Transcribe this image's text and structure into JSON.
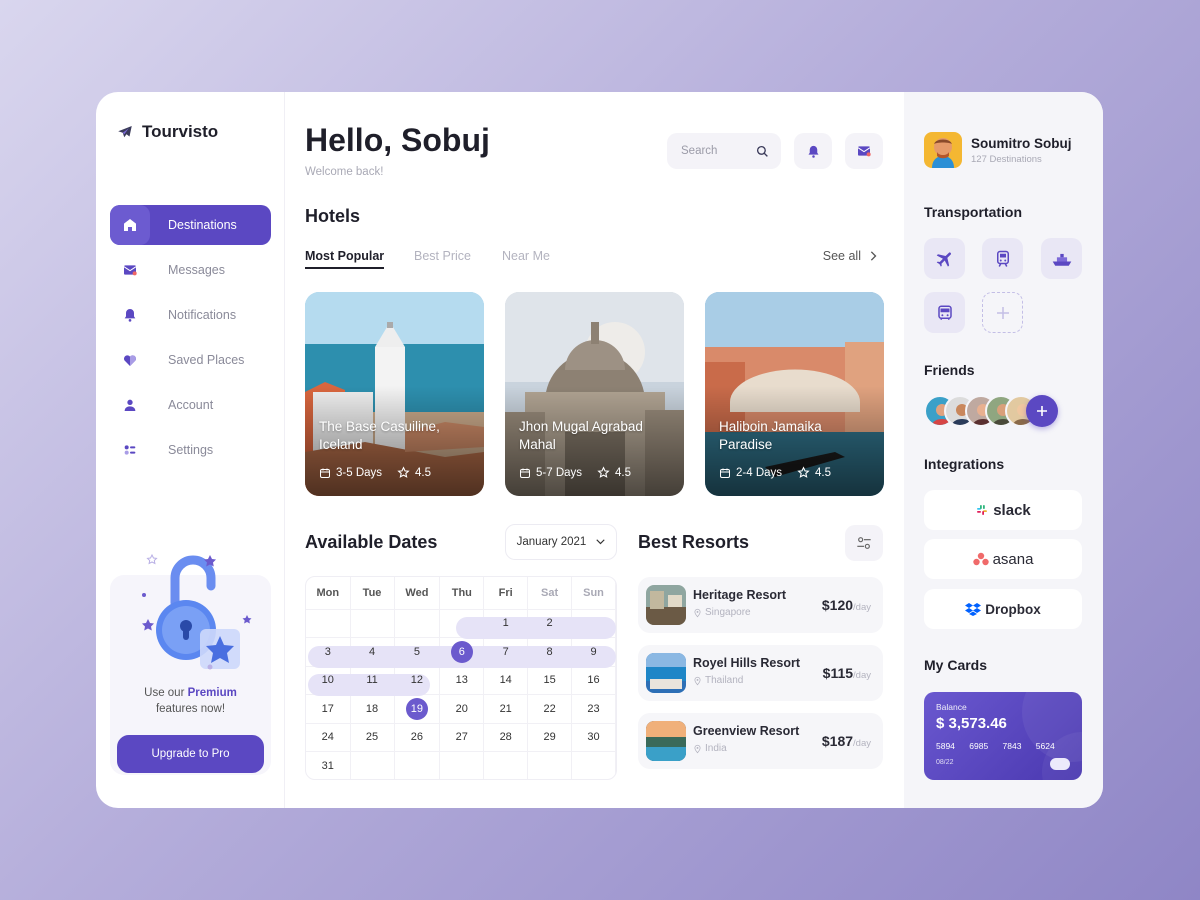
{
  "app": {
    "name": "Tourvisto"
  },
  "sidebar": {
    "items": [
      {
        "label": "Destinations",
        "icon": "home-icon",
        "active": true
      },
      {
        "label": "Messages",
        "icon": "mail-icon"
      },
      {
        "label": "Notifications",
        "icon": "bell-icon"
      },
      {
        "label": "Saved Places",
        "icon": "heart-icon"
      },
      {
        "label": "Account",
        "icon": "user-icon"
      },
      {
        "label": "Settings",
        "icon": "settings-icon"
      }
    ],
    "promo": {
      "text_before": "Use our",
      "highlight": "Premium",
      "text_after": "features now!",
      "button": "Upgrade to Pro"
    }
  },
  "header": {
    "greeting": "Hello, Sobuj",
    "subtitle": "Welcome back!",
    "search_placeholder": "Search"
  },
  "hotels": {
    "title": "Hotels",
    "tabs": [
      "Most Popular",
      "Best Price",
      "Near Me"
    ],
    "active_tab": "Most Popular",
    "see_all": "See all",
    "items": [
      {
        "name": "The Base Casuiline, Iceland",
        "days": "3-5 Days",
        "rating": "4.5"
      },
      {
        "name": "Jhon Mugal Agrabad Mahal",
        "days": "5-7 Days",
        "rating": "4.5"
      },
      {
        "name": "Haliboin Jamaika Paradise",
        "days": "2-4 Days",
        "rating": "4.5"
      }
    ]
  },
  "dates": {
    "title": "Available Dates",
    "month": "January 2021",
    "weekdays": [
      "Mon",
      "Tue",
      "Wed",
      "Thu",
      "Fri",
      "Sat",
      "Sun"
    ],
    "weeks": [
      [
        "",
        "",
        "",
        "",
        "1",
        "2",
        ""
      ],
      [
        "3",
        "4",
        "5",
        "6",
        "7",
        "8",
        "9"
      ],
      [
        "10",
        "11",
        "12",
        "13",
        "14",
        "15",
        "16"
      ],
      [
        "17",
        "18",
        "19",
        "20",
        "21",
        "22",
        "23"
      ],
      [
        "24",
        "25",
        "26",
        "27",
        "28",
        "29",
        "30"
      ],
      [
        "31",
        "",
        "",
        "",
        "",
        "",
        ""
      ]
    ],
    "selected_start": "6",
    "selected_end": "19"
  },
  "resorts": {
    "title": "Best Resorts",
    "items": [
      {
        "name": "Heritage Resort",
        "location": "Singapore",
        "price": "$120",
        "unit": "/day"
      },
      {
        "name": "Royel Hills Resort",
        "location": "Thailand",
        "price": "$115",
        "unit": "/day"
      },
      {
        "name": "Greenview Resort",
        "location": "India",
        "price": "$187",
        "unit": "/day"
      }
    ]
  },
  "profile": {
    "name": "Soumitro Sobuj",
    "subtitle": "127 Destinations"
  },
  "transportation": {
    "title": "Transportation",
    "items": [
      "plane-icon",
      "train-icon",
      "ship-icon",
      "bus-icon",
      "add-icon"
    ]
  },
  "friends": {
    "title": "Friends"
  },
  "integrations": {
    "title": "Integrations",
    "items": [
      "slack",
      "asana",
      "Dropbox"
    ]
  },
  "cards": {
    "title": "My Cards",
    "balance_label": "Balance",
    "balance": "$ 3,573.46",
    "number": "5894 6985 7843 5624",
    "expiry": "08/22"
  },
  "colors": {
    "accent": "#5b48c2",
    "range": "#e6e3f7",
    "panel": "#f5f5f9"
  }
}
